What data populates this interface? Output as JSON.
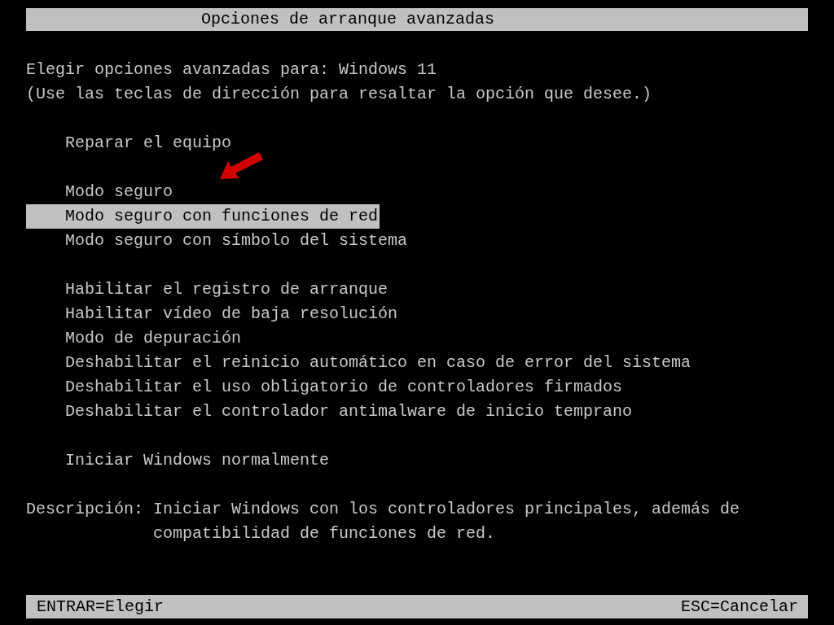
{
  "title": "Opciones de arranque avanzadas",
  "header": {
    "prompt": "Elegir opciones avanzadas para:",
    "os": "Windows 11",
    "hint": "(Use las teclas de dirección para resaltar la opción que desee.)"
  },
  "menu_groups": [
    {
      "items": [
        {
          "label": "Reparar el equipo",
          "selected": false
        }
      ]
    },
    {
      "items": [
        {
          "label": "Modo seguro",
          "selected": false
        },
        {
          "label": "Modo seguro con funciones de red",
          "selected": true
        },
        {
          "label": "Modo seguro con símbolo del sistema",
          "selected": false
        }
      ]
    },
    {
      "items": [
        {
          "label": "Habilitar el registro de arranque",
          "selected": false
        },
        {
          "label": "Habilitar vídeo de baja resolución",
          "selected": false
        },
        {
          "label": "Modo de depuración",
          "selected": false
        },
        {
          "label": "Deshabilitar el reinicio automático en caso de error del sistema",
          "selected": false
        },
        {
          "label": "Deshabilitar el uso obligatorio de controladores firmados",
          "selected": false
        },
        {
          "label": "Deshabilitar el controlador antimalware de inicio temprano",
          "selected": false
        }
      ]
    },
    {
      "items": [
        {
          "label": "Iniciar Windows normalmente",
          "selected": false
        }
      ]
    }
  ],
  "description": {
    "label": "Descripción:",
    "text": "Iniciar Windows con los controladores principales, además de compatibilidad de funciones de red."
  },
  "footer": {
    "left": "ENTRAR=Elegir",
    "right": "ESC=Cancelar"
  }
}
